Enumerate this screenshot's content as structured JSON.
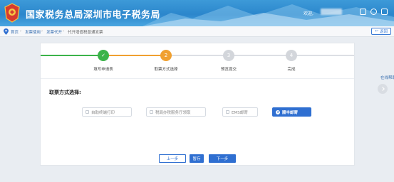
{
  "header": {
    "site_title": "国家税务总局深圳市电子税务局",
    "welcome_text": "欢迎,",
    "colors": {
      "bar": "#2b86cc",
      "accent": "#2f6fd1"
    }
  },
  "breadcrumb": {
    "items": [
      "首页",
      "发票使用",
      "发票代开",
      "代开增值税普通发票"
    ],
    "back_label": "返回"
  },
  "steps": [
    {
      "label": "填写申请表",
      "status": "completed",
      "glyph": "✓"
    },
    {
      "label": "取票方式选择",
      "status": "current",
      "glyph": "2"
    },
    {
      "label": "预览提交",
      "status": "pending",
      "glyph": "3"
    },
    {
      "label": "完成",
      "status": "pending",
      "glyph": "4"
    }
  ],
  "pickup": {
    "label": "取票方式选择:",
    "options": [
      {
        "label": "自助终端打印",
        "selected": false
      },
      {
        "label": "税局办税服务厅领取",
        "selected": false
      },
      {
        "label": "EMS邮寄",
        "selected": false
      },
      {
        "label": "顺丰邮寄",
        "selected": true
      }
    ]
  },
  "actions": {
    "prev": "上一步",
    "save": "暂存",
    "next": "下一步"
  },
  "side": {
    "online_help": "在线帮助"
  }
}
